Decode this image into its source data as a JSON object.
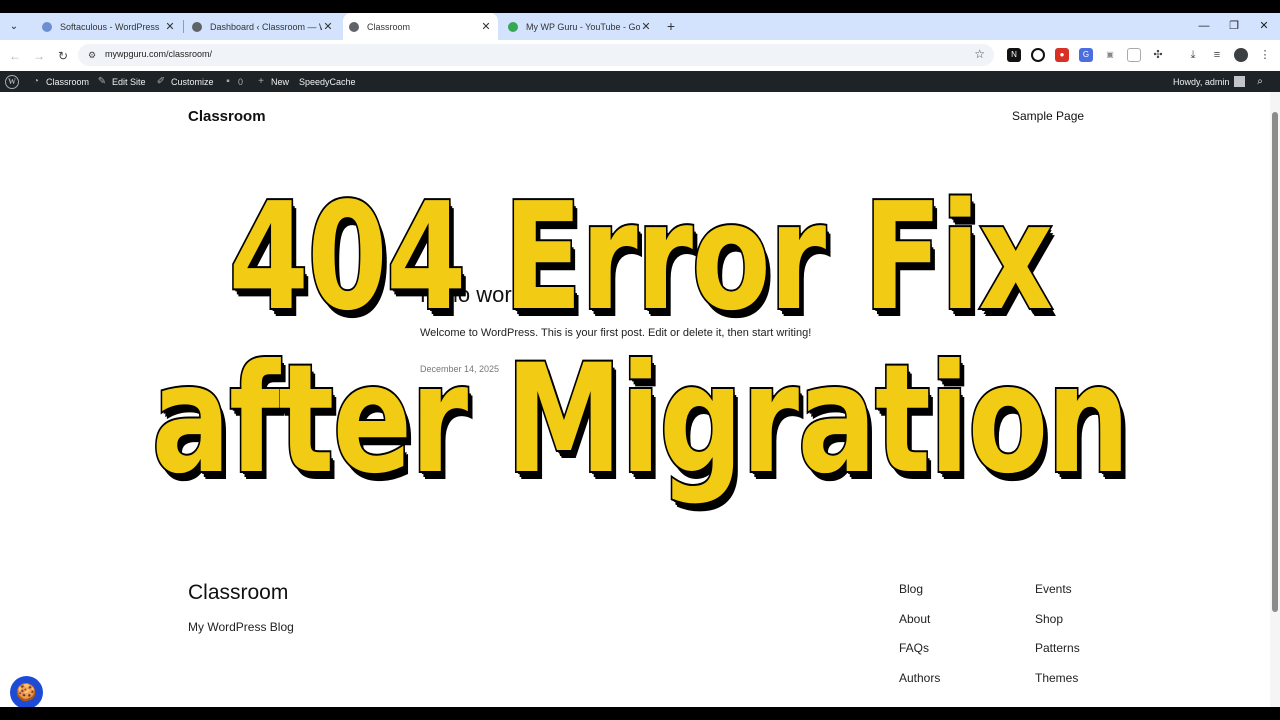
{
  "browser": {
    "tabs": [
      {
        "title": "Softaculous - WordPress",
        "favicon_color": "#6b8fcf",
        "active": false
      },
      {
        "title": "Dashboard ‹ Classroom — WordPress",
        "favicon_color": "#5f6368",
        "active": false
      },
      {
        "title": "Classroom",
        "favicon_color": "#5f6368",
        "active": true
      },
      {
        "title": "My WP Guru - YouTube - Google",
        "favicon_color": "#34a853",
        "active": false
      }
    ],
    "tab_close": "✕",
    "new_tab": "+",
    "url": "mywpguru.com/classroom/",
    "window_controls": {
      "minimize": "—",
      "maximize": "❐",
      "close": "✕"
    }
  },
  "adminbar": {
    "site_name": "Classroom",
    "edit_site": "Edit Site",
    "customize": "Customize",
    "comments_count": "0",
    "new": "New",
    "cache": "SpeedyCache",
    "howdy": "Howdy, admin"
  },
  "site": {
    "title": "Classroom",
    "nav": [
      "Sample Page"
    ],
    "post_title": "Hello world!",
    "post_excerpt": "Welcome to WordPress. This is your first post. Edit or delete it, then start writing!",
    "post_date": "December 14, 2025"
  },
  "footer": {
    "title": "Classroom",
    "tagline": "My WordPress Blog",
    "col1": [
      "Blog",
      "About",
      "FAQs",
      "Authors"
    ],
    "col2": [
      "Events",
      "Shop",
      "Patterns",
      "Themes"
    ]
  },
  "overlay": {
    "line1": "404 Error Fix",
    "line2": "after Migration",
    "color": "#f2cb14"
  }
}
